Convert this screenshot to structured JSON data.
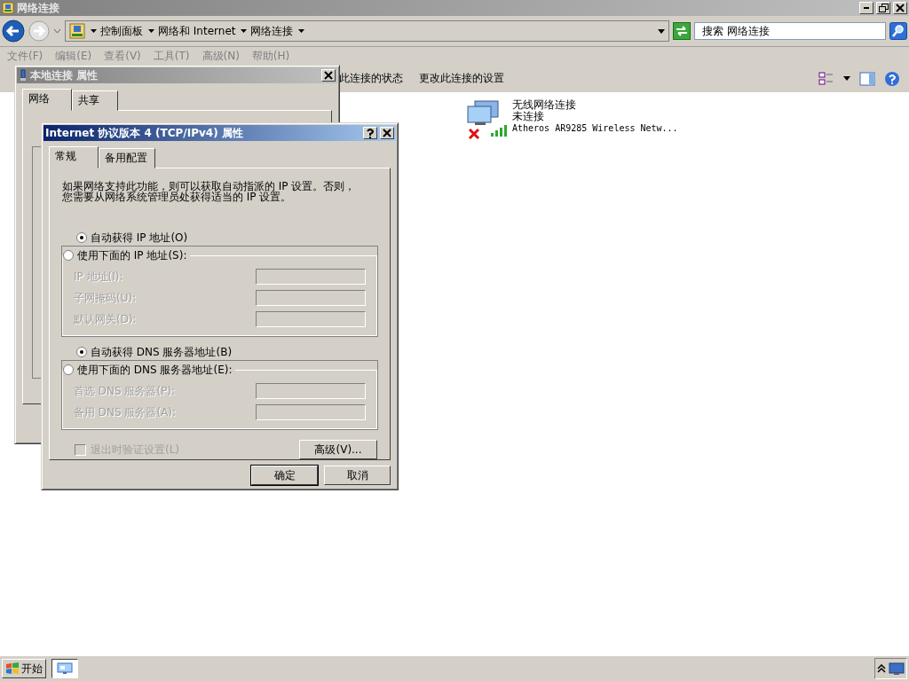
{
  "explorer": {
    "title": "网络连接",
    "breadcrumbs": [
      "控制面板",
      "网络和 Internet",
      "网络连接"
    ],
    "search": {
      "placeholder": "搜索 网络连接"
    },
    "menu": [
      "文件(F)",
      "编辑(E)",
      "查看(V)",
      "工具(T)",
      "高级(N)",
      "帮助(H)"
    ],
    "commands": [
      "此连接的状态",
      "更改此连接的设置"
    ],
    "connections": [
      {
        "name": "无线网络连接",
        "status": "未连接",
        "adapter": "Atheros AR9285 Wireless Netw...",
        "disconnected": true
      }
    ]
  },
  "properties_dialog": {
    "title": "本地连接 属性",
    "tabs": [
      {
        "label": "网络",
        "selected": true
      },
      {
        "label": "共享",
        "selected": false
      }
    ]
  },
  "ipv4_dialog": {
    "title": "Internet 协议版本 4 (TCP/IPv4) 属性",
    "tabs": [
      {
        "label": "常规",
        "selected": true
      },
      {
        "label": "备用配置",
        "selected": false
      }
    ],
    "description": "如果网络支持此功能，则可以获取自动指派的 IP 设置。否则，您需要从网络系统管理员处获得适当的 IP 设置。",
    "ip_options": [
      {
        "label": "自动获得 IP 地址(O)",
        "selected": true
      },
      {
        "label": "使用下面的 IP 地址(S):",
        "selected": false
      }
    ],
    "ip_fields": [
      {
        "label": "IP 地址(I):",
        "disabled": true
      },
      {
        "label": "子网掩码(U):",
        "disabled": true
      },
      {
        "label": "默认网关(D):",
        "disabled": true
      }
    ],
    "dns_options": [
      {
        "label": "自动获得 DNS 服务器地址(B)",
        "selected": true
      },
      {
        "label": "使用下面的 DNS 服务器地址(E):",
        "selected": false
      }
    ],
    "dns_fields": [
      {
        "label": "首选 DNS 服务器(P):",
        "disabled": true
      },
      {
        "label": "备用 DNS 服务器(A):",
        "disabled": true
      }
    ],
    "validate": {
      "label": "退出时验证设置(L)",
      "checked": false,
      "disabled": true
    },
    "advanced_button": "高级(V)...",
    "buttons": [
      "确定",
      "取消"
    ]
  },
  "taskbar": {
    "start": "开始"
  }
}
